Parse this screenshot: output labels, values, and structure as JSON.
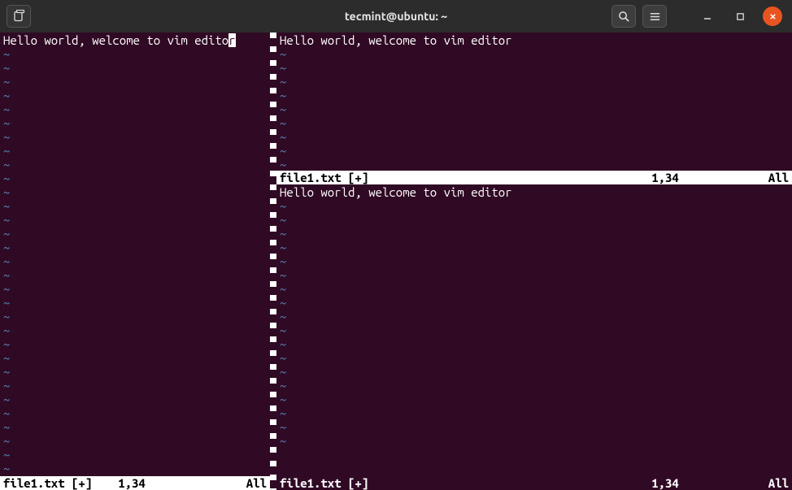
{
  "window": {
    "title": "tecmint@ubuntu: ~"
  },
  "panes": {
    "left": {
      "content": "Hello world, welcome to vim edito",
      "cursor_char": "r",
      "filename": "file1.txt",
      "modified": "[+]",
      "position": "1,34",
      "scroll": "All"
    },
    "right_top": {
      "content": "Hello world, welcome to vim editor",
      "filename": "file1.txt",
      "modified": "[+]",
      "position": "1,34",
      "scroll": "All"
    },
    "right_bottom": {
      "content": "Hello world, welcome to vim editor",
      "filename": "file1.txt",
      "modified": "[+]",
      "position": "1,34",
      "scroll": "All"
    }
  },
  "tilde": "~"
}
